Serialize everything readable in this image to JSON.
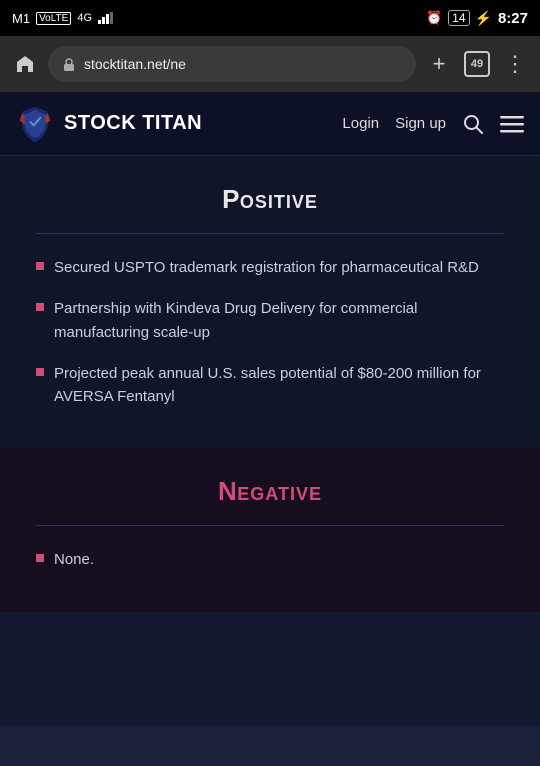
{
  "statusBar": {
    "carrier": "M1",
    "network": "VoLTE",
    "signal": "4G",
    "alarmIcon": "alarm",
    "batteryLevel": "14",
    "charging": true,
    "time": "8:27"
  },
  "browser": {
    "homeIcon": "⌂",
    "urlIcon": "◎",
    "url": "stocktitan.net/ne",
    "addTabIcon": "+",
    "tabsCount": "49",
    "menuIcon": "⋮"
  },
  "header": {
    "logoText": "STOCK TITAN",
    "loginLabel": "Login",
    "signupLabel": "Sign up"
  },
  "positive": {
    "title_first": "P",
    "title_rest": "ositive",
    "title_display": "Positive",
    "bullets": [
      "Secured USPTO trademark registration for pharmaceutical R&D",
      "Partnership with Kindeva Drug Delivery for commercial manufacturing scale-up",
      "Projected peak annual U.S. sales potential of $80-200 million for AVERSA Fentanyl"
    ]
  },
  "negative": {
    "title_first": "N",
    "title_rest": "egative",
    "title_display": "Negative",
    "bullets": [
      "None."
    ]
  },
  "colors": {
    "accent_pink": "#d44a7a",
    "bg_dark": "#0f1628",
    "bg_negative": "#160d1e",
    "text_light": "#c8d0e0"
  }
}
